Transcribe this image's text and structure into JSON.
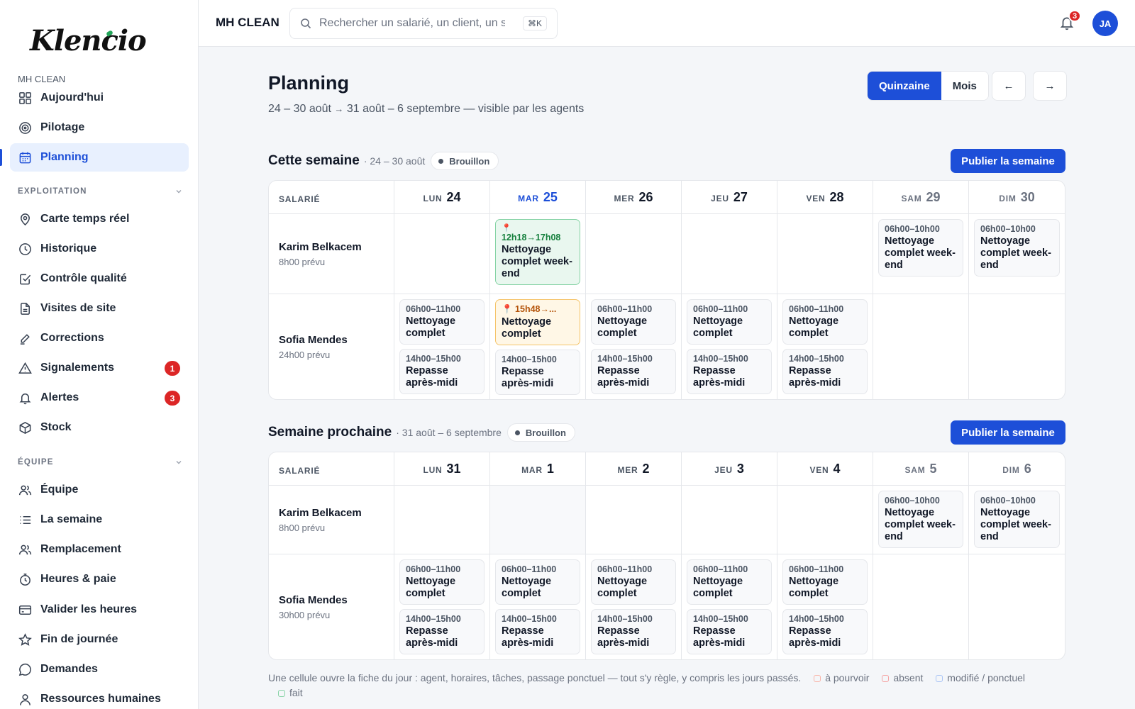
{
  "sidebar": {
    "logo": "Klencio",
    "company": "MH CLEAN",
    "top_items": [
      {
        "label": "Aujourd'hui"
      },
      {
        "label": "Pilotage"
      },
      {
        "label": "Planning"
      }
    ],
    "section_exploitation": "EXPLOITATION",
    "exploitation_items": [
      {
        "label": "Carte temps réel"
      },
      {
        "label": "Historique"
      },
      {
        "label": "Contrôle qualité"
      },
      {
        "label": "Visites de site"
      },
      {
        "label": "Corrections"
      },
      {
        "label": "Signalements",
        "badge": "1"
      },
      {
        "label": "Alertes",
        "badge": "3"
      },
      {
        "label": "Stock"
      }
    ],
    "section_equipe": "ÉQUIPE",
    "equipe_items": [
      {
        "label": "Équipe"
      },
      {
        "label": "La semaine"
      },
      {
        "label": "Remplacement"
      },
      {
        "label": "Heures & paie"
      },
      {
        "label": "Valider les heures"
      },
      {
        "label": "Fin de journée"
      },
      {
        "label": "Demandes"
      },
      {
        "label": "Ressources humaines"
      }
    ]
  },
  "topbar": {
    "brand": "MH CLEAN",
    "search_placeholder": "Rechercher un salarié, un client, un si",
    "shortcut": "⌘K",
    "notifications": "3",
    "avatar": "JA"
  },
  "header": {
    "title": "Planning",
    "subtitle_a": "24 – 30 août",
    "subtitle_arrow": "→",
    "subtitle_b": "31 août – 6 septembre — visible par les agents",
    "view_quinzaine": "Quinzaine",
    "view_mois": "Mois",
    "prev": "←",
    "next": "→"
  },
  "weeks": [
    {
      "title": "Cette semaine",
      "range": "· 24 – 30 août",
      "status": "Brouillon",
      "publish": "Publier la semaine",
      "col_header": "SALARIÉ",
      "days": [
        {
          "name": "LUN",
          "num": "24"
        },
        {
          "name": "MAR",
          "num": "25"
        },
        {
          "name": "MER",
          "num": "26"
        },
        {
          "name": "JEU",
          "num": "27"
        },
        {
          "name": "VEN",
          "num": "28"
        },
        {
          "name": "SAM",
          "num": "29"
        },
        {
          "name": "DIM",
          "num": "30"
        }
      ],
      "employees": [
        {
          "name": "Karim Belkacem",
          "hours": "8h00 prévu"
        },
        {
          "name": "Sofia Mendes",
          "hours": "24h00 prévu"
        }
      ],
      "shifts": {
        "karim_mar": {
          "pin": "📍",
          "time": "12h18→17h08",
          "task": "Nettoyage complet week-end"
        },
        "karim_sam": {
          "time": "06h00–10h00",
          "task": "Nettoyage complet week-end"
        },
        "karim_dim": {
          "time": "06h00–10h00",
          "task": "Nettoyage complet week-end"
        },
        "sofia_lun_1": {
          "time": "06h00–11h00",
          "task": "Nettoyage complet"
        },
        "sofia_lun_2": {
          "time": "14h00–15h00",
          "task": "Repasse après-midi"
        },
        "sofia_mar_1": {
          "time": "📍 15h48→...",
          "task": "Nettoyage complet"
        },
        "sofia_mar_2": {
          "time": "14h00–15h00",
          "task": "Repasse après-midi"
        },
        "sofia_mer_1": {
          "time": "06h00–11h00",
          "task": "Nettoyage complet"
        },
        "sofia_mer_2": {
          "time": "14h00–15h00",
          "task": "Repasse après-midi"
        },
        "sofia_jeu_1": {
          "time": "06h00–11h00",
          "task": "Nettoyage complet"
        },
        "sofia_jeu_2": {
          "time": "14h00–15h00",
          "task": "Repasse après-midi"
        },
        "sofia_ven_1": {
          "time": "06h00–11h00",
          "task": "Nettoyage complet"
        },
        "sofia_ven_2": {
          "time": "14h00–15h00",
          "task": "Repasse après-midi"
        }
      }
    },
    {
      "title": "Semaine prochaine",
      "range": "· 31 août – 6 septembre",
      "status": "Brouillon",
      "publish": "Publier la semaine",
      "col_header": "SALARIÉ",
      "days": [
        {
          "name": "LUN",
          "num": "31"
        },
        {
          "name": "MAR",
          "num": "1"
        },
        {
          "name": "MER",
          "num": "2"
        },
        {
          "name": "JEU",
          "num": "3"
        },
        {
          "name": "VEN",
          "num": "4"
        },
        {
          "name": "SAM",
          "num": "5"
        },
        {
          "name": "DIM",
          "num": "6"
        }
      ],
      "employees": [
        {
          "name": "Karim Belkacem",
          "hours": "8h00 prévu"
        },
        {
          "name": "Sofia Mendes",
          "hours": "30h00 prévu"
        }
      ],
      "shifts": {
        "karim_sam": {
          "time": "06h00–10h00",
          "task": "Nettoyage complet week-end"
        },
        "karim_dim": {
          "time": "06h00–10h00",
          "task": "Nettoyage complet week-end"
        },
        "sofia_lun_1": {
          "time": "06h00–11h00",
          "task": "Nettoyage complet"
        },
        "sofia_lun_2": {
          "time": "14h00–15h00",
          "task": "Repasse après-midi"
        },
        "sofia_mar_1": {
          "time": "06h00–11h00",
          "task": "Nettoyage complet"
        },
        "sofia_mar_2": {
          "time": "14h00–15h00",
          "task": "Repasse après-midi"
        },
        "sofia_mer_1": {
          "time": "06h00–11h00",
          "task": "Nettoyage complet"
        },
        "sofia_mer_2": {
          "time": "14h00–15h00",
          "task": "Repasse après-midi"
        },
        "sofia_jeu_1": {
          "time": "06h00–11h00",
          "task": "Nettoyage complet"
        },
        "sofia_jeu_2": {
          "time": "14h00–15h00",
          "task": "Repasse après-midi"
        },
        "sofia_ven_1": {
          "time": "06h00–11h00",
          "task": "Nettoyage complet"
        },
        "sofia_ven_2": {
          "time": "14h00–15h00",
          "task": "Repasse après-midi"
        }
      }
    }
  ],
  "legend": {
    "text": "Une cellule ouvre la fiche du jour : agent, horaires, tâches, passage ponctuel — tout s'y règle, y compris les jours passés.",
    "a_pourvoir": "à pourvoir",
    "absent": "absent",
    "modifie": "modifié / ponctuel",
    "fait": "fait"
  },
  "colors": {
    "accent": "#1d4fd8",
    "badge": "#dc2626",
    "done_border": "#86d3a5",
    "warn_border": "#f5c46a"
  }
}
